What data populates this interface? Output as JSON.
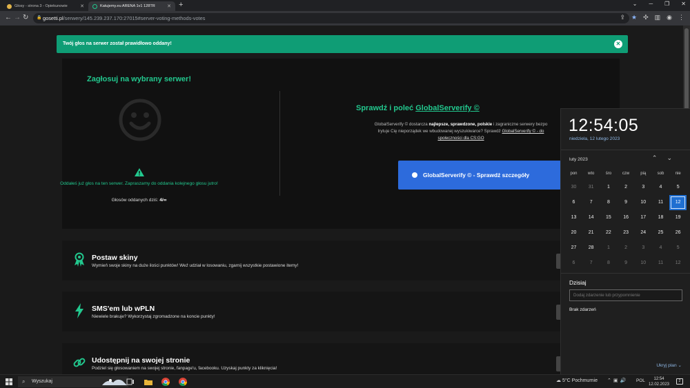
{
  "browser": {
    "tabs": [
      {
        "title": "Głosy - strona 3 - Opiekunowie",
        "active": false
      },
      {
        "title": "Katujemy.eu ARENA 1v1 128TR",
        "active": true
      }
    ],
    "new_tab": "+",
    "url": {
      "host": "gosetti.pl",
      "path": "/serwery/145.239.237.170:27015#server-voting-methods-votes"
    }
  },
  "page": {
    "alert": "Twój głos na serwer został prawidłowo oddany!",
    "vote": {
      "title": "Zagłosuj na wybrany serwer!",
      "voted_message": "Oddałeś już głos na ten serwer. Zapraszamy do oddania kolejnego głosu jutro!",
      "votes_today_label": "Głosów oddanych dziś:",
      "votes_today_value": "4/∞"
    },
    "globalserverify": {
      "title_prefix": "Sprawdź i poleć",
      "title_link": "GlobalServerify ©",
      "desc_1a": "GlobalServerify © dostarcza",
      "desc_1b": "najlepsze, sprawdzone, polskie",
      "desc_1c": "i zagraniczne serwery bezpo",
      "desc_2a": "Irytuje Cię nieporządek we wbudowanej wyszukiwarce? Sprawdź",
      "desc_2b": "GlobalServerify © - do",
      "desc_3": "społeczności dla CS:GO",
      "button": "GlobalServerify © - Sprawdź szczegóły"
    },
    "features": [
      {
        "title": "Postaw skiny",
        "desc": "Wymień swoje skiny na duże ilości punktów! Weź udział w losowaniu, zgarnij wszystkie postawione itemy!"
      },
      {
        "title": "SMS'em lub wPLN",
        "desc": "Niewiele brakuje? Wykorzystaj zgromadzone na koncie punkty!"
      },
      {
        "title": "Udostępnij na swojej stronie",
        "desc": "Podziel się głosowaniem na swojej stronie, fanpage'u, facebooku. Uzyskaj punkty za kliknięcia!"
      }
    ]
  },
  "calendar": {
    "time": "12:54:05",
    "date_long": "niedziela, 12 lutego 2023",
    "month_label": "luty 2023",
    "weekdays": [
      "pon",
      "wto",
      "śro",
      "czw",
      "pią",
      "sob",
      "nie"
    ],
    "weeks": [
      [
        "30",
        "31",
        "1",
        "2",
        "3",
        "4",
        "5"
      ],
      [
        "6",
        "7",
        "8",
        "9",
        "10",
        "11",
        "12"
      ],
      [
        "13",
        "14",
        "15",
        "16",
        "17",
        "18",
        "19"
      ],
      [
        "20",
        "21",
        "22",
        "23",
        "24",
        "25",
        "26"
      ],
      [
        "27",
        "28",
        "1",
        "2",
        "3",
        "4",
        "5"
      ],
      [
        "6",
        "7",
        "8",
        "9",
        "10",
        "11",
        "12"
      ]
    ],
    "today_label": "Dzisiaj",
    "event_placeholder": "Dodaj zdarzenie lub przypomnienie",
    "no_events": "Brak zdarzeń",
    "hide_plan": "Ukryj plan"
  },
  "taskbar": {
    "search": "Wyszukaj",
    "weather": "5°C  Pochmurnie",
    "language": "POL",
    "clock_time": "12:54",
    "clock_date": "12.02.2023",
    "notifications": "2"
  },
  "colors": {
    "accent_green": "#22c88e",
    "alert_green": "#0f9d75",
    "button_blue": "#2d6bdc",
    "today_blue": "#1f6fd1"
  }
}
